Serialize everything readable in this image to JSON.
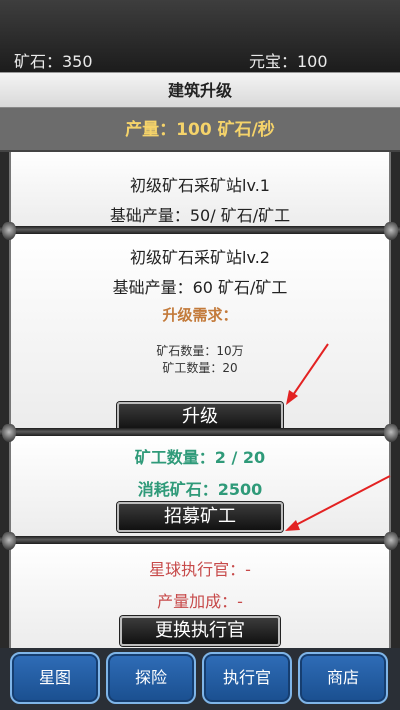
{
  "top": {
    "ore": "矿石：350",
    "gold": "元宝：100"
  },
  "title": "建筑升级",
  "production": "产量：100 矿石/秒",
  "current": {
    "name": "初级矿石采矿站lv.1",
    "rate": "基础产量：50/ 矿石/矿工"
  },
  "next": {
    "name": "初级矿石采矿站lv.2",
    "rate": "基础产量：60 矿石/矿工",
    "req_title": "升级需求：",
    "req_ore": "矿石数量：10万",
    "req_miner": "矿工数量：20",
    "button": "升级"
  },
  "miners": {
    "count": "矿工数量：2 / 20",
    "cost": "消耗矿石：2500",
    "button": "招募矿工"
  },
  "officer": {
    "name": "星球执行官：-",
    "bonus": "产量加成：-",
    "button": "更换执行官"
  },
  "nav": [
    "星图",
    "探险",
    "执行官",
    "商店"
  ],
  "colors": {
    "accent_gold": "#f5d36a",
    "green": "#2f9a79",
    "red": "#c74a4a",
    "orange": "#c37a3a",
    "nav_blue": "#2f6db8",
    "arrow": "#e32222"
  }
}
